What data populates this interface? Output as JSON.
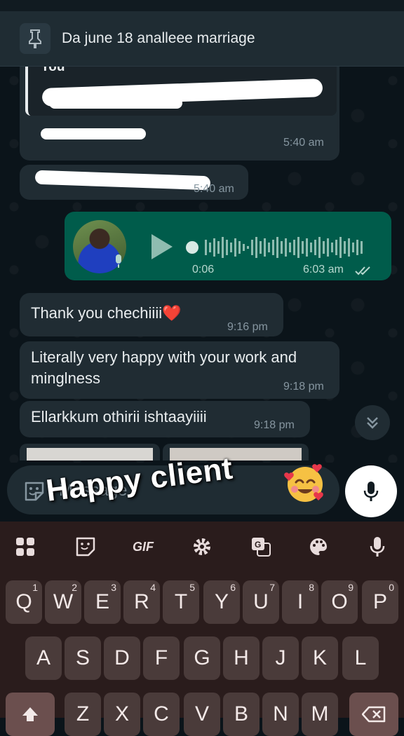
{
  "pinned": {
    "title": "Da june 18 analleee marriage"
  },
  "messages": {
    "m1": {
      "quote_author": "You",
      "time": "5:40 am"
    },
    "m2": {
      "time": "5:40 am"
    },
    "voice": {
      "duration": "0:06",
      "time": "6:03 am",
      "status": "read"
    },
    "m3": {
      "text": "Thank you chechiiii❤️",
      "time": "9:16 pm"
    },
    "m4": {
      "text": "Literally very happy with your work and minglness",
      "time": "9:18 pm"
    },
    "m5": {
      "text": "Ellarkkum othirii ishtaayiiii",
      "time": "9:18 pm"
    }
  },
  "composer": {
    "placeholder": "Message"
  },
  "overlay": {
    "caption": "Happy client",
    "emoji": "smiling-face-with-hearts"
  },
  "keyboard": {
    "toolbar": [
      "apps-grid-icon",
      "sticker-icon",
      "GIF",
      "settings-icon",
      "translate-icon",
      "palette-icon",
      "voice-input-icon"
    ],
    "gif_label": "GIF",
    "row1": [
      {
        "key": "Q",
        "hint": "1"
      },
      {
        "key": "W",
        "hint": "2"
      },
      {
        "key": "E",
        "hint": "3"
      },
      {
        "key": "R",
        "hint": "4"
      },
      {
        "key": "T",
        "hint": "5"
      },
      {
        "key": "Y",
        "hint": "6"
      },
      {
        "key": "U",
        "hint": "7"
      },
      {
        "key": "I",
        "hint": "8"
      },
      {
        "key": "O",
        "hint": "9"
      },
      {
        "key": "P",
        "hint": "0"
      }
    ],
    "row2": [
      "A",
      "S",
      "D",
      "F",
      "G",
      "H",
      "J",
      "K",
      "L"
    ],
    "row3": [
      "Z",
      "X",
      "C",
      "V",
      "B",
      "N",
      "M"
    ]
  },
  "colors": {
    "background": "#0b141a",
    "incoming_bubble": "#202c33",
    "outgoing_bubble": "#005c4b",
    "keyboard": "#2a1c1c",
    "key": "#4a3b3a"
  }
}
